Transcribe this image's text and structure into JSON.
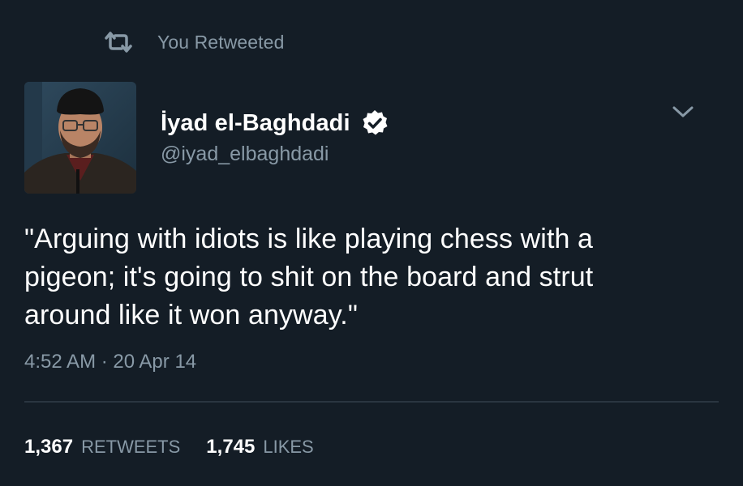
{
  "retweet_context": {
    "icon": "retweet-icon",
    "text": "You Retweeted"
  },
  "author": {
    "display_name": "İyad el-Baghdadi",
    "handle": "@iyad_elbaghdadi",
    "verified_icon": "verified-badge-icon",
    "avatar_icon": "avatar"
  },
  "menu": {
    "icon": "chevron-down-icon"
  },
  "tweet": {
    "lines": [
      "\"Arguing with idiots is like playing chess with a",
      "pigeon; it's going to shit on the board and strut",
      "around like it won anyway.\""
    ],
    "timestamp": "4:52 AM · 20 Apr 14"
  },
  "stats": {
    "retweets_count": "1,367",
    "retweets_label": "RETWEETS",
    "likes_count": "1,745",
    "likes_label": "LIKES"
  },
  "colors": {
    "background": "#141d26",
    "primary_text": "#ffffff",
    "secondary_text": "#8899a6",
    "divider": "#2a3540"
  }
}
